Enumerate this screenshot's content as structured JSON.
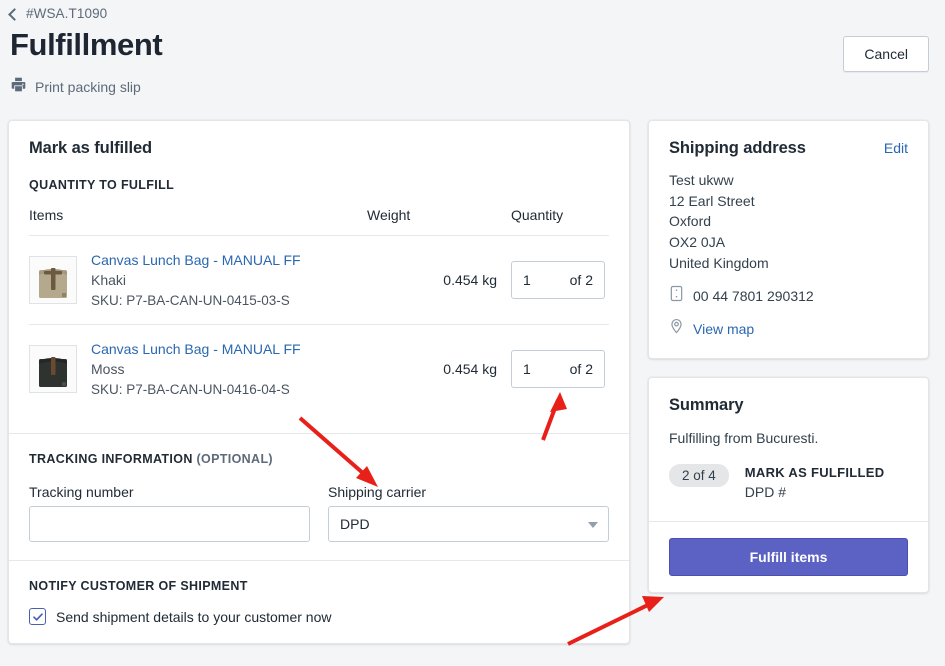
{
  "header": {
    "breadcrumb": "#WSA.T1090",
    "back_icon": "chevron-left-icon",
    "title": "Fulfillment",
    "print_icon": "printer-icon",
    "print_label": "Print packing slip",
    "cancel_label": "Cancel"
  },
  "fulfill_card": {
    "heading": "Mark as fulfilled",
    "quantity_subhead": "QUANTITY TO FULFILL",
    "columns": {
      "items": "Items",
      "weight": "Weight",
      "quantity": "Quantity"
    },
    "items": [
      {
        "title": "Canvas Lunch Bag - MANUAL FF",
        "variant": "Khaki",
        "sku": "SKU: P7-BA-CAN-UN-0415-03-S",
        "weight": "0.454 kg",
        "qty_value": "1",
        "qty_of": "of 2",
        "thumb_color": "#b5a98d",
        "thumb_strap": "#6b5a3e"
      },
      {
        "title": "Canvas Lunch Bag - MANUAL FF",
        "variant": "Moss",
        "sku": "SKU: P7-BA-CAN-UN-0416-04-S",
        "weight": "0.454 kg",
        "qty_value": "1",
        "qty_of": "of 2",
        "thumb_color": "#2f3330",
        "thumb_strap": "#6b4a31"
      }
    ]
  },
  "tracking": {
    "subhead_main": "TRACKING INFORMATION",
    "subhead_optional": "(OPTIONAL)",
    "number_label": "Tracking number",
    "number_value": "",
    "number_placeholder": "",
    "carrier_label": "Shipping carrier",
    "carrier_value": "DPD",
    "carrier_caret_icon": "chevron-down-icon"
  },
  "notify": {
    "subhead": "NOTIFY CUSTOMER OF SHIPMENT",
    "checkbox_icon": "checkmark-icon",
    "checkbox_checked": true,
    "label": "Send shipment details to your customer now"
  },
  "shipping_address": {
    "title": "Shipping address",
    "edit_label": "Edit",
    "lines": [
      "Test ukww",
      "12 Earl Street",
      "Oxford",
      "OX2 0JA",
      "United Kingdom"
    ],
    "phone_icon": "mobile-phone-icon",
    "phone": "00 44 7801 290312",
    "map_icon": "map-pin-icon",
    "map_label": "View map"
  },
  "summary": {
    "title": "Summary",
    "fulfilling_from": "Fulfilling from Bucuresti.",
    "badge": "2 of 4",
    "status": "MARK AS FULFILLED",
    "carrier": "DPD #",
    "fulfill_button": "Fulfill items"
  },
  "colors": {
    "accent_button": "#5c61c4",
    "link": "#2a67b1",
    "annotation_arrow": "#e8201a",
    "page_background": "#f4f5f7"
  },
  "annotations": [
    {
      "name": "arrow-to-shipping-carrier"
    },
    {
      "name": "arrow-to-quantity-field"
    },
    {
      "name": "arrow-to-fulfill-items-button"
    }
  ]
}
